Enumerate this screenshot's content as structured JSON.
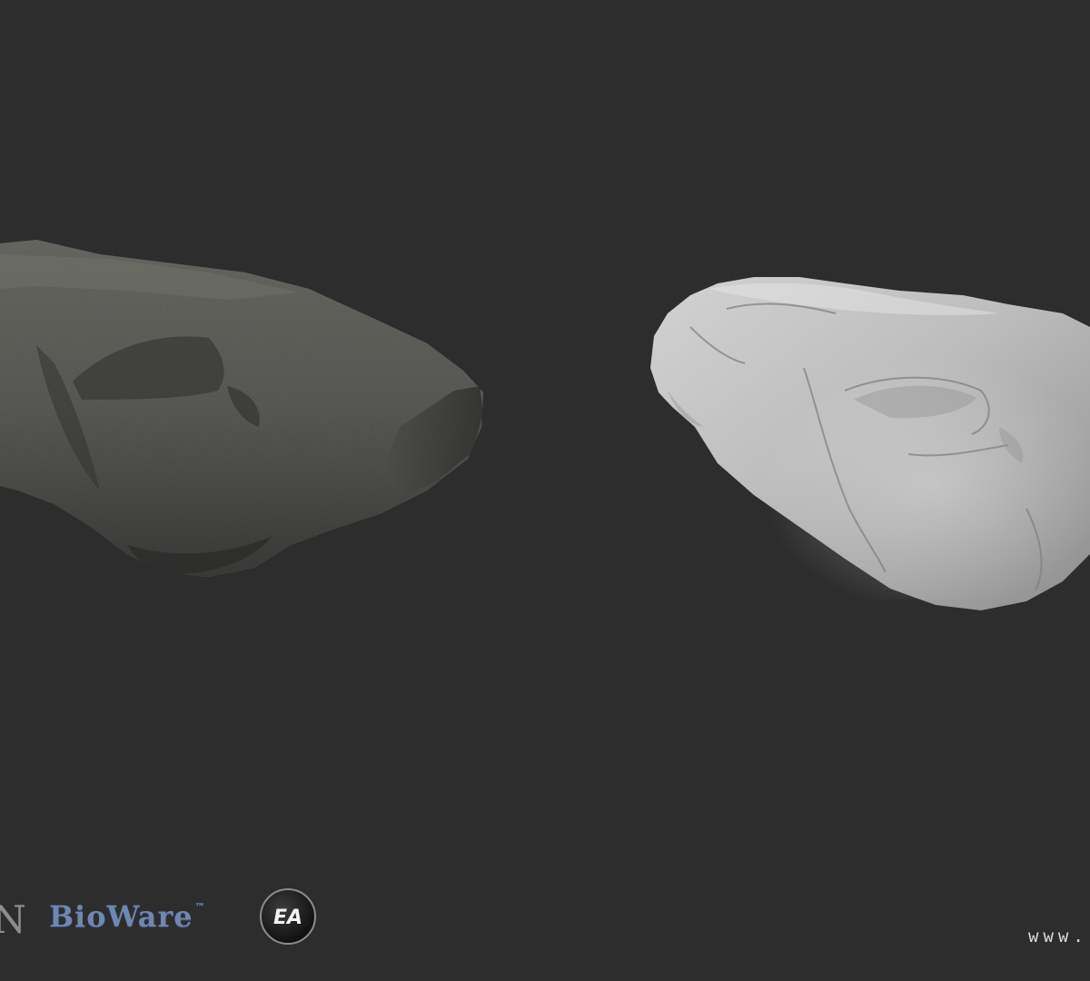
{
  "logos": {
    "partial_left_letter": "N",
    "bioware": "BioWare",
    "bioware_tm": "™",
    "ea": "EA"
  },
  "website_partial": "www.",
  "colors": {
    "background": "#2d2d2e",
    "textured_rock": "#5a5a57",
    "sculpt_rock": "#bfbfbf",
    "bioware_blue": "#6f87b3"
  },
  "icons": [
    "textured-rock-model",
    "untextured-sculpt-model",
    "ea-logo-icon"
  ]
}
